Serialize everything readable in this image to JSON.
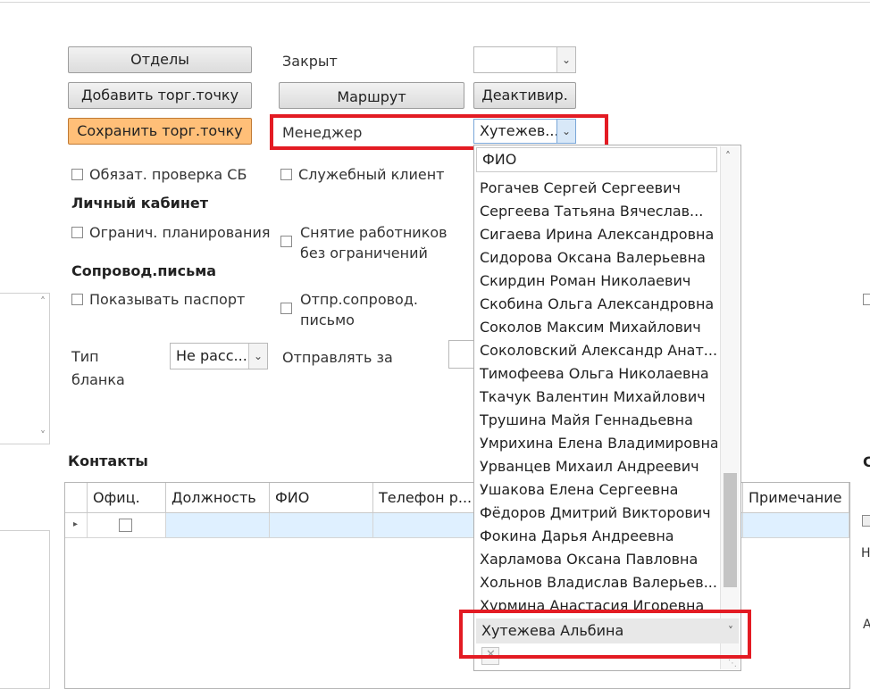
{
  "buttons": {
    "departments": "Отделы",
    "add_point": "Добавить торг.точку",
    "save_point": "Сохранить торг.точку",
    "route": "Маршрут",
    "deactivate": "Деактивир."
  },
  "fields": {
    "closed_label": "Закрыт",
    "closed_value": "",
    "manager_label": "Менеджер",
    "manager_value": "Хутежев...",
    "blank_type_label_1": "Тип",
    "blank_type_label_2": "бланка",
    "blank_type_value": "Не расс...",
    "send_for_label": "Отправлять за"
  },
  "checkboxes": {
    "sb_check": "Обязат. проверка СБ",
    "service_client": "Служебный клиент",
    "limit_planning": "Огранич. планирования",
    "remove_workers_1": "Снятие работников",
    "remove_workers_2": "без ограничений",
    "show_passport": "Показывать паспорт",
    "send_cover_1": "Отпр.сопровод.",
    "send_cover_2": "письмо"
  },
  "sections": {
    "personal_cabinet": "Личный кабинет",
    "cover_letters": "Сопровод.письма",
    "contacts": "Контакты"
  },
  "dropdown": {
    "header": "ФИО",
    "items": [
      "Рогачев Сергей Сергеевич",
      "Сергеева Татьяна Вячеслав...",
      "Сигаева Ирина Александровна",
      "Сидорова Оксана Валерьевна",
      "Скирдин Роман Николаевич",
      "Скобина Ольга Александровна",
      "Соколов Максим Михайлович",
      "Соколовский Александр Анат...",
      "Тимофеева Ольга Николаевна",
      "Ткачук Валентин Михайлович",
      "Трушина Майя Геннадьевна",
      "Умрихина Елена Владимировна",
      "Урванцев Михаил Андреевич",
      "Ушакова Елена Сергеевна",
      "Фёдоров Дмитрий Викторович",
      "Фокина Дарья Андреевна",
      "Харламова Оксана Павловна",
      "Хольнов Владислав Валерьев...",
      "Хурмина Анастасия Игоревна"
    ],
    "selected": "Хутежева Альбина"
  },
  "grid": {
    "columns": [
      "Офиц.",
      "Должность",
      "ФИО",
      "Телефон р...",
      "Примечание"
    ]
  },
  "right_edge": {
    "letter_c": "С",
    "letter_h": "Н",
    "letter_a": "А"
  },
  "colors": {
    "highlight_red": "#e31b23",
    "save_button": "#ffbf78",
    "grid_row": "#dff0ff"
  }
}
